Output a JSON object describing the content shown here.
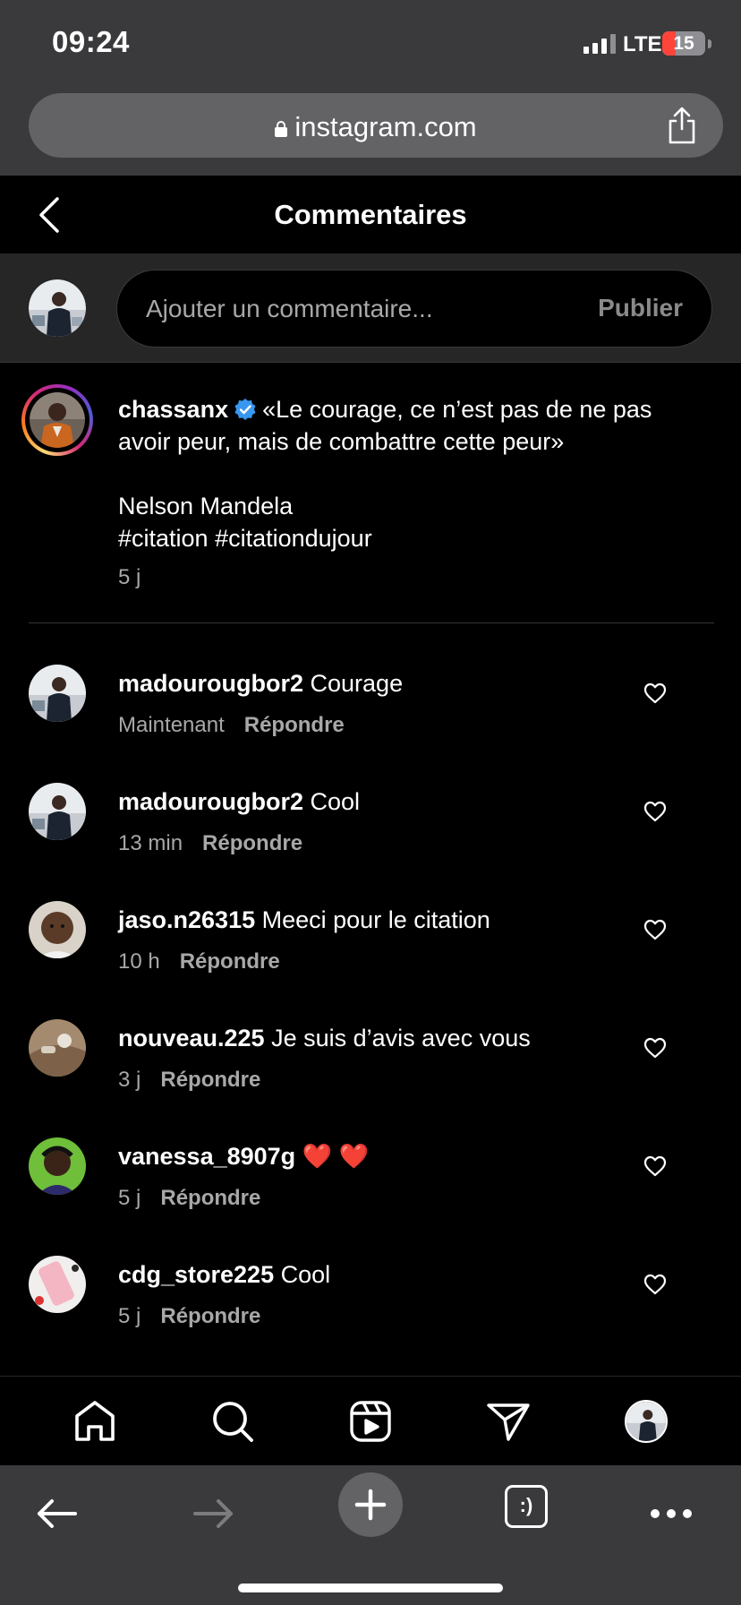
{
  "status_bar": {
    "time": "09:24",
    "network": "LTE",
    "battery": "15"
  },
  "browser": {
    "url": "instagram.com"
  },
  "header": {
    "title": "Commentaires"
  },
  "composer": {
    "placeholder": "Ajouter un commentaire...",
    "publish_label": "Publier"
  },
  "caption": {
    "username": "chassanx",
    "verified": true,
    "lines": [
      "«Le courage, ce n’est pas de ne pas",
      "avoir peur, mais de combattre cette peur»",
      "",
      "Nelson Mandela",
      "#citation #citationdujour"
    ],
    "time": "5 j"
  },
  "comments": [
    {
      "username": "madourougbor2",
      "text": "Courage",
      "time": "Maintenant",
      "reply_label": "Répondre"
    },
    {
      "username": "madourougbor2",
      "text": "Cool",
      "time": "13 min",
      "reply_label": "Répondre"
    },
    {
      "username": "jaso.n26315",
      "text": "Meeci pour le citation",
      "time": "10 h",
      "reply_label": "Répondre"
    },
    {
      "username": "nouveau.225",
      "text": "Je suis d’avis avec vous",
      "time": "3 j",
      "reply_label": "Répondre"
    },
    {
      "username": "vanessa_8907g",
      "text": "❤️ ❤️",
      "time": "5 j",
      "reply_label": "Répondre"
    },
    {
      "username": "cdg_store225",
      "text": "Cool",
      "time": "5 j",
      "reply_label": "Répondre"
    }
  ],
  "bottom_nav": {
    "items": [
      "home-icon",
      "search-icon",
      "reels-icon",
      "direct-message-icon",
      "profile-avatar"
    ]
  },
  "browser_toolbar": {
    "items": [
      "back-arrow-icon",
      "forward-arrow-icon",
      "new-tab-plus-icon",
      "tabs-icon",
      "more-icon"
    ],
    "tabs_label": ":)"
  },
  "colors": {
    "verified_blue": "#3897f0",
    "muted_text": "#a8a8a8",
    "battery_low": "#ff453a"
  }
}
